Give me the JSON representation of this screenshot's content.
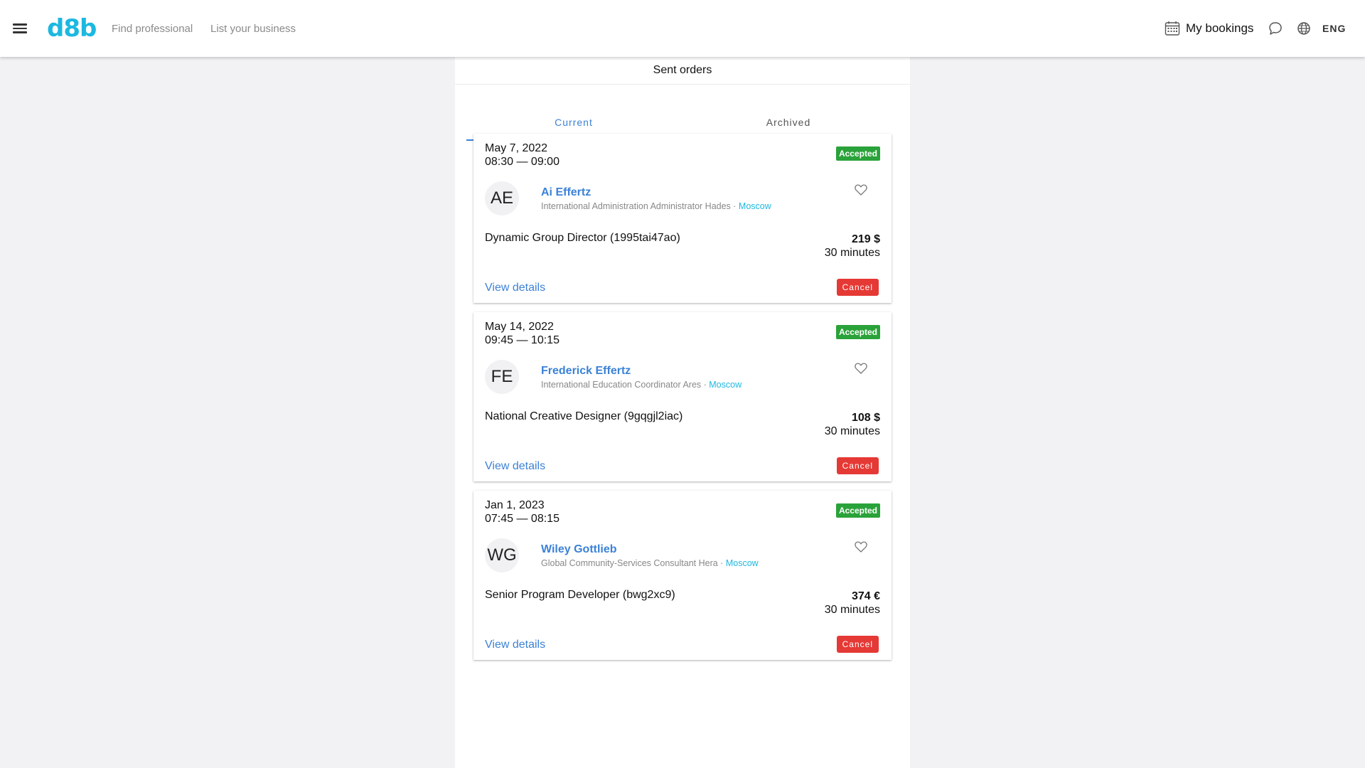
{
  "header": {
    "logo": "d8b",
    "nav": {
      "find_professional": "Find professional",
      "list_business": "List your business"
    },
    "my_bookings": "My bookings",
    "language": "ENG"
  },
  "page": {
    "title": "Sent orders",
    "tabs": [
      "Current",
      "Archived"
    ],
    "active_tab": "Current"
  },
  "colors": {
    "brand": "#1cb8e0",
    "link": "#3b82d6",
    "accepted": "#2aa23a",
    "cancel": "#e53935"
  },
  "orders": [
    {
      "date": "May 7, 2022",
      "time": "08:30 — 09:00",
      "status": "Accepted",
      "initials": "AE",
      "name": "Ai Effertz",
      "title": "International Administration Administrator Hades",
      "separator": " · ",
      "city": "Moscow",
      "service": "Dynamic Group Director (1995tai47ao)",
      "price": "219 $",
      "duration": "30 minutes",
      "details_label": "View details",
      "cancel_label": "Cancel"
    },
    {
      "date": "May 14, 2022",
      "time": "09:45 — 10:15",
      "status": "Accepted",
      "initials": "FE",
      "name": "Frederick Effertz",
      "title": "International Education Coordinator Ares",
      "separator": " · ",
      "city": "Moscow",
      "service": "National Creative Designer (9gqgjl2iac)",
      "price": "108 $",
      "duration": "30 minutes",
      "details_label": "View details",
      "cancel_label": "Cancel"
    },
    {
      "date": "Jan 1, 2023",
      "time": "07:45 — 08:15",
      "status": "Accepted",
      "initials": "WG",
      "name": "Wiley Gottlieb",
      "title": "Global Community-Services Consultant Hera",
      "separator": " · ",
      "city": "Moscow",
      "service": "Senior Program Developer (bwg2xc9)",
      "price": "374 €",
      "duration": "30 minutes",
      "details_label": "View details",
      "cancel_label": "Cancel"
    }
  ]
}
